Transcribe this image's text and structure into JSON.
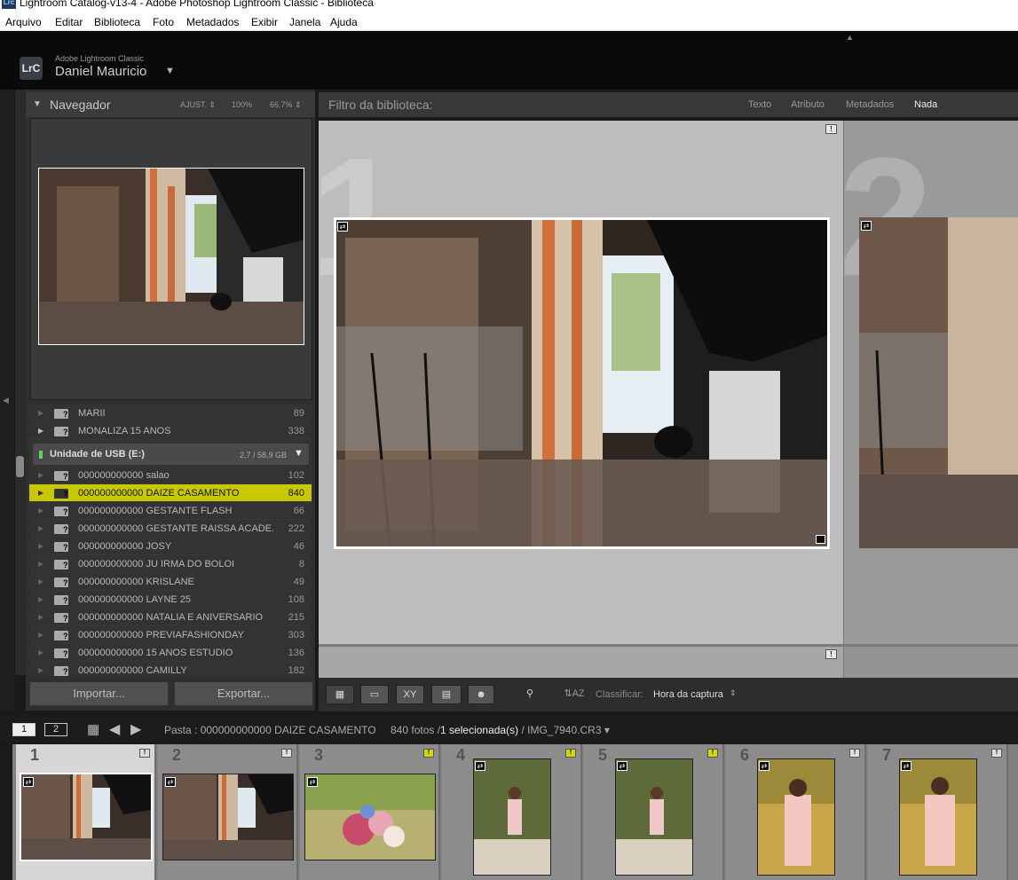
{
  "window": {
    "title": "Lightroom Catalog-v13-4 - Adobe Photoshop Lightroom Classic - Biblioteca",
    "app_icon": "Lrc"
  },
  "menu": [
    "Arquivo",
    "Editar",
    "Biblioteca",
    "Foto",
    "Metadados",
    "Exibir",
    "Janela",
    "Ajuda"
  ],
  "identity": {
    "logo": "LrC",
    "product": "Adobe Lightroom Classic",
    "user": "Daniel Mauricio"
  },
  "navigator": {
    "title": "Navegador",
    "fit": "AJUST.",
    "zoom1": "100%",
    "zoom2": "66.7%"
  },
  "folders": {
    "top_rows": [
      {
        "name": "MARII",
        "count": "89"
      },
      {
        "name": "MONALIZA 15 ANOS",
        "count": "338"
      }
    ],
    "volume": {
      "name": "Unidade de USB (E:)",
      "size": "2,7 / 58,9 GB"
    },
    "rows": [
      {
        "name": "000000000000 salao",
        "count": "102"
      },
      {
        "name": "000000000000 DAIZE CASAMENTO",
        "count": "840"
      },
      {
        "name": "000000000000 GESTANTE FLASH",
        "count": "66"
      },
      {
        "name": "000000000000 GESTANTE RAISSA ACADE...",
        "count": "222"
      },
      {
        "name": "000000000000 JOSY",
        "count": "46"
      },
      {
        "name": "000000000000 JU IRMA DO BOLOI",
        "count": "8"
      },
      {
        "name": "000000000000 KRISLANE",
        "count": "49"
      },
      {
        "name": "000000000000 LAYNE 25",
        "count": "108"
      },
      {
        "name": "000000000000 NATALIA E ANIVERSARIO",
        "count": "215"
      },
      {
        "name": "000000000000 PREVIAFASHIONDAY",
        "count": "303"
      },
      {
        "name": "000000000000 15 ANOS ESTUDIO",
        "count": "136"
      },
      {
        "name": "000000000000 CAMILLY",
        "count": "182"
      }
    ]
  },
  "buttons": {
    "import": "Importar...",
    "export": "Exportar..."
  },
  "filter": {
    "title": "Filtro da biblioteca:",
    "options": [
      "Texto",
      "Atributo",
      "Metadados",
      "Nada"
    ],
    "active": "Nada"
  },
  "grid": {
    "numbers": [
      "1",
      "2"
    ]
  },
  "toolbar": {
    "sort_label": "Classificar:",
    "sort_value": "Hora da captura",
    "compare_label": "XY"
  },
  "stripbar": {
    "monitor1": "1",
    "monitor2": "2",
    "path": "Pasta : 000000000000 DAIZE CASAMENTO",
    "count": "840 fotos /",
    "selected": "1 selecionada(s)",
    "file": "/ IMG_7940.CR3"
  },
  "filmstrip": [
    "1",
    "2",
    "3",
    "4",
    "5",
    "6",
    "7"
  ],
  "colors": {
    "selection": "#c8c800",
    "panel": "#2f2f2f",
    "grid_bg": "#bdbdbd"
  }
}
